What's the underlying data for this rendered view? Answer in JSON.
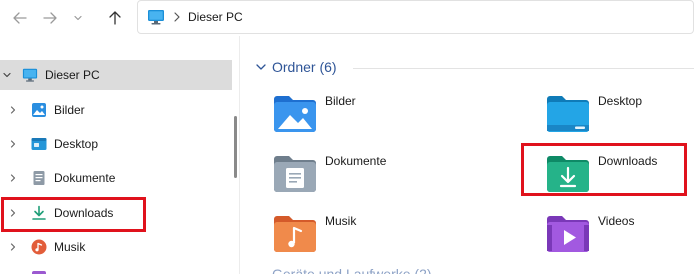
{
  "address": {
    "location": "Dieser PC"
  },
  "sidebar": {
    "root": {
      "label": "Dieser PC"
    },
    "items": [
      {
        "label": "Bilder",
        "icon": "pictures-icon"
      },
      {
        "label": "Desktop",
        "icon": "desktop-icon"
      },
      {
        "label": "Dokumente",
        "icon": "documents-icon"
      },
      {
        "label": "Downloads",
        "icon": "downloads-icon"
      },
      {
        "label": "Musik",
        "icon": "music-icon"
      }
    ]
  },
  "content": {
    "group_title": "Ordner (6)",
    "folders": [
      {
        "label": "Bilder",
        "icon": "pictures-folder-icon"
      },
      {
        "label": "Desktop",
        "icon": "desktop-folder-icon"
      },
      {
        "label": "Dokumente",
        "icon": "documents-folder-icon"
      },
      {
        "label": "Downloads",
        "icon": "downloads-folder-icon"
      },
      {
        "label": "Musik",
        "icon": "music-folder-icon"
      },
      {
        "label": "Videos",
        "icon": "videos-folder-icon"
      }
    ],
    "next_group_partial": "Geräte und Laufwerke (2)"
  },
  "colors": {
    "highlight": "#e0121c",
    "group_title": "#2f5597",
    "selected_row": "#dcdcdc"
  }
}
